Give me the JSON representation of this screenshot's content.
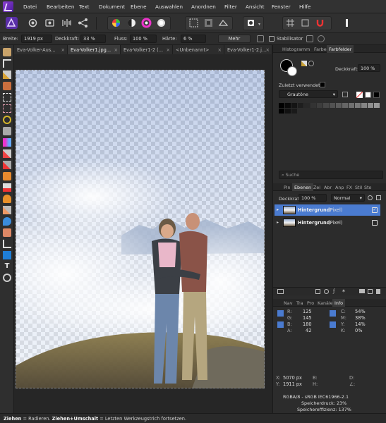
{
  "menu": [
    "Datei",
    "Bearbeiten",
    "Text",
    "Dokument",
    "Ebene",
    "Auswahlen",
    "Anordnen",
    "Filter",
    "Ansicht",
    "Fenster",
    "Hilfe"
  ],
  "context_bar": {
    "width_label": "Breite:",
    "width_value": "1919 px",
    "opacity_label": "Deckkraft:",
    "opacity_value": "33 %",
    "flow_label": "Fluss:",
    "flow_value": "100 %",
    "hardness_label": "Härte:",
    "hardness_value": "6 %",
    "more_label": "Mehr",
    "stabilizer_label": "Stabilisator"
  },
  "doc_tabs": [
    {
      "label": "Eva-Volker-Aus..."
    },
    {
      "label": "Eva-Volker1.jpg..."
    },
    {
      "label": "Eva-Volker1-2 (..."
    },
    {
      "label": "<Unbenannt>"
    },
    {
      "label": "Eva-Volker1-2.j..."
    }
  ],
  "color_panel": {
    "tabs": [
      "Histogramm",
      "Farbe",
      "Farbfelder"
    ],
    "opacity_label": "Deckkraft:",
    "opacity_value": "100 %",
    "recent_label": "Zuletzt verwendet:",
    "palette": "Grautöne"
  },
  "search_placeholder": "Suche",
  "layers_panel": {
    "tabs": [
      "Pin",
      "Ebenen",
      "Zei",
      "Abr",
      "Anp",
      "FX",
      "Stil",
      "Sto"
    ],
    "opacity_label": "Deckkraft:",
    "opacity_value": "100 %",
    "blend_mode": "Normal",
    "layers": [
      {
        "name": "Hintergrund",
        "type": "(Pixel)",
        "selected": true,
        "visible_check": "✓"
      },
      {
        "name": "Hintergrund",
        "type": "(Pixel)",
        "selected": false,
        "visible_check": ""
      }
    ]
  },
  "info_panel": {
    "tabs": [
      "Nav",
      "Tra",
      "Pro",
      "Kanäle",
      "Info"
    ],
    "rgb": [
      {
        "k": "R:",
        "v": "125"
      },
      {
        "k": "G:",
        "v": "145"
      },
      {
        "k": "B:",
        "v": "180"
      },
      {
        "k": "A:",
        "v": "42"
      }
    ],
    "cmyk": [
      {
        "k": "C:",
        "v": "54%"
      },
      {
        "k": "M:",
        "v": "38%"
      },
      {
        "k": "Y:",
        "v": "14%"
      },
      {
        "k": "K:",
        "v": "0%"
      }
    ],
    "x_label": "X:",
    "x_value": "5070 px",
    "y_label": "Y:",
    "y_value": "1911 px",
    "b_label": "B:",
    "h_label": "H:",
    "d_label": "D:",
    "w_label": "∠:",
    "format": "RGBA/8 - sRGB IEC61966-2.1",
    "mem_pressure": "Speicherdruck: 23%",
    "mem_efficiency": "Speichereffizienz: 137%"
  },
  "status": {
    "drag_label": "Ziehen",
    "drag_text": " = Radieren. ",
    "drag_shift_label": "Ziehen+Umschalt",
    "drag_shift_text": " = Letzten Werkzeugstrich fortsetzen."
  },
  "colors": {
    "accent": "#4a7bd0",
    "brand": "#7b2fc9",
    "background": "#2b2b2b"
  }
}
